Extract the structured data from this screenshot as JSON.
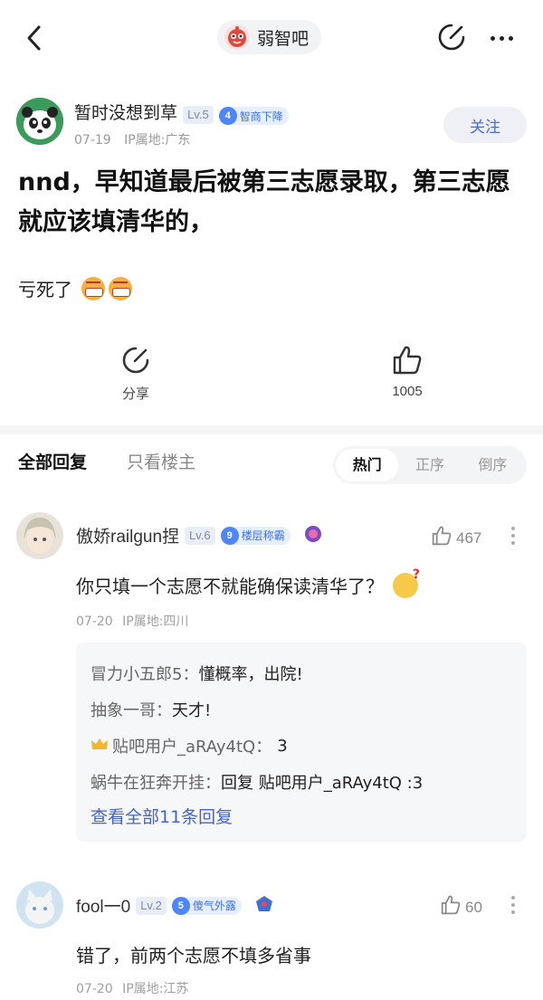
{
  "header": {
    "forum_name": "弱智吧",
    "icons": {
      "back": "back-arrow-icon",
      "edit": "edit-icon",
      "more": "more-icon"
    }
  },
  "post": {
    "author": {
      "name": "暂时没想到草",
      "level": "Lv.5",
      "badge_num": "4",
      "badge_text": "智商下降",
      "date": "07-19",
      "ip": "IP属地:广东"
    },
    "follow_label": "关注",
    "title": "nnd，早知道最后被第三志愿录取，第三志愿就应该填清华的，",
    "body": "亏死了",
    "share_label": "分享",
    "like_count": "1005"
  },
  "tabs": {
    "all": "全部回复",
    "op_only": "只看楼主",
    "sort": [
      "热门",
      "正序",
      "倒序"
    ],
    "sort_active": "热门"
  },
  "comments": [
    {
      "name": "傲娇railgun捏",
      "level": "Lv.6",
      "badge_num": "9",
      "badge_text": "楼层称霸",
      "likes": "467",
      "text": "你只填一个志愿不就能确保读清华了？",
      "date": "07-20",
      "ip": "IP属地:四川",
      "replies": [
        {
          "who": "冒力小五郎5：",
          "text": "懂概率，出院!"
        },
        {
          "who": "抽象一哥：",
          "text": "天才!"
        },
        {
          "who": "贴吧用户_aRAy4tQ：",
          "text": "3"
        },
        {
          "who": "蜗牛在狂奔开挂：",
          "text": "回复 贴吧用户_aRAy4tQ :3"
        }
      ],
      "view_all": "查看全部11条回复"
    },
    {
      "name": "fool一0",
      "level": "Lv.2",
      "badge_num": "5",
      "badge_text": "傻气外露",
      "likes": "60",
      "text": "错了，前两个志愿不填多省事",
      "date": "07-20",
      "ip": "IP属地:江苏"
    }
  ]
}
